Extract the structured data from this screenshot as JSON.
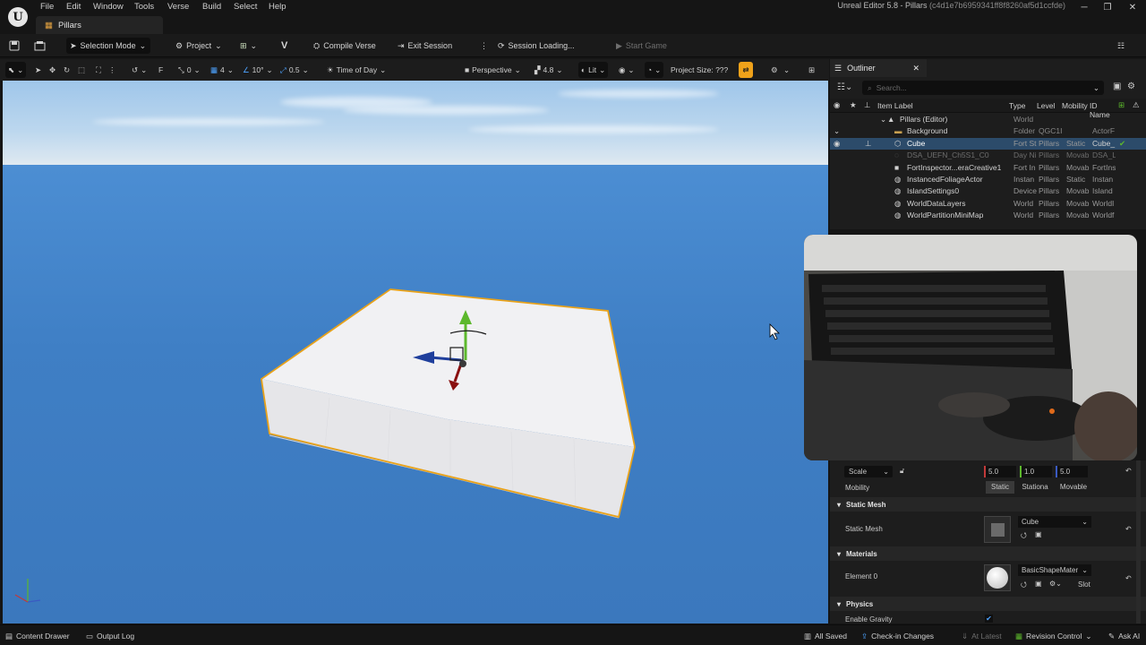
{
  "menu": {
    "items": [
      "File",
      "Edit",
      "Window",
      "Tools",
      "Verse",
      "Build",
      "Select",
      "Help"
    ],
    "document_tab": "Pillars",
    "window_title": "Unreal Editor 5.8 - Pillars",
    "window_hash": "(c4d1e7b6959341ff8f8260af5d1ccfde)"
  },
  "toolbar": {
    "selection_mode": "Selection Mode",
    "project": "Project",
    "compile_verse": "Compile Verse",
    "exit_session": "Exit Session",
    "session_status": "Session Loading...",
    "start_game": "Start Game"
  },
  "viewport_toolbar": {
    "snap_rotate": "0",
    "grid_size": "4",
    "rotation_snap": "10°",
    "scale_snap": "0.5",
    "time_of_day": "Time of Day",
    "perspective": "Perspective",
    "camera_speed": "4.8",
    "lit": "Lit",
    "project_size": "Project Size: ???"
  },
  "outliner": {
    "tab": "Outliner",
    "search_placeholder": "Search...",
    "columns": [
      "Item Label",
      "Type",
      "Level",
      "Mobility",
      "ID Name"
    ],
    "rows": [
      {
        "label": "Pillars (Editor)",
        "type": "World",
        "level": "",
        "mobility": "",
        "id": ""
      },
      {
        "label": "Background",
        "type": "Folder",
        "level": "QGC1I",
        "mobility": "",
        "id": "ActorF"
      },
      {
        "label": "Cube",
        "type": "Fort St",
        "level": "Pillars",
        "mobility": "Static",
        "id": "Cube_"
      },
      {
        "label": "DSA_UEFN_Ch5S1_C0",
        "type": "Day Ni",
        "level": "Pillars",
        "mobility": "Movab",
        "id": "DSA_L"
      },
      {
        "label": "FortInspector...eraCreative1",
        "type": "Fort In",
        "level": "Pillars",
        "mobility": "Movab",
        "id": "FortIns"
      },
      {
        "label": "InstancedFoliageActor",
        "type": "Instan",
        "level": "Pillars",
        "mobility": "Static",
        "id": "Instan"
      },
      {
        "label": "IslandSettings0",
        "type": "Device",
        "level": "Pillars",
        "mobility": "Movab",
        "id": "Island"
      },
      {
        "label": "WorldDataLayers",
        "type": "World",
        "level": "Pillars",
        "mobility": "Movab",
        "id": "WorldI"
      },
      {
        "label": "WorldPartitionMiniMap",
        "type": "World",
        "level": "Pillars",
        "mobility": "Movab",
        "id": "Worldf"
      }
    ]
  },
  "details": {
    "scale_label": "Scale",
    "scale_x": "5.0",
    "scale_y": "1.0",
    "scale_z": "5.0",
    "mobility_label": "Mobility",
    "mobility_options": [
      "Static",
      "Stationa",
      "Movable"
    ],
    "static_mesh_section": "Static Mesh",
    "static_mesh_label": "Static Mesh",
    "static_mesh_value": "Cube",
    "materials_section": "Materials",
    "element0_label": "Element 0",
    "element0_value": "BasicShapeMater",
    "slot_label": "Slot",
    "physics_section": "Physics",
    "enable_gravity_label": "Enable Gravity"
  },
  "statusbar": {
    "content_drawer": "Content Drawer",
    "output_log": "Output Log",
    "all_saved": "All Saved",
    "check_in": "Check-in Changes",
    "at_latest": "At Latest",
    "revision_control": "Revision Control",
    "ask_ai": "Ask AI"
  },
  "colors": {
    "selection_outline": "#e8a21a",
    "sky": "#bcd7ee",
    "ocean": "#3f7fc4",
    "outliner_selected": "#2c4b6a"
  }
}
